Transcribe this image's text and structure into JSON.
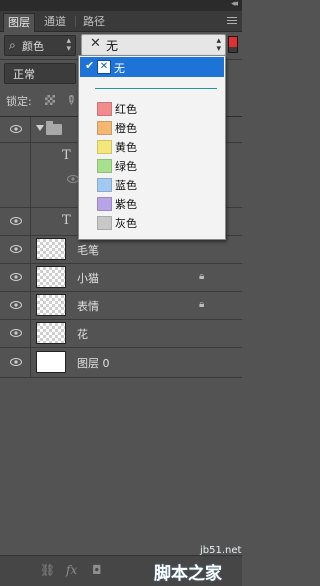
{
  "panel": {
    "tabs": [
      {
        "label": "图层",
        "active": true
      },
      {
        "label": "通道",
        "active": false
      },
      {
        "label": "路径",
        "active": false
      }
    ]
  },
  "filter": {
    "kind_label": "颜色",
    "color_value": "无"
  },
  "blend_mode": "正常",
  "lock_label": "锁定:",
  "layers": [
    {
      "type": "group",
      "name": "",
      "visible": true
    },
    {
      "type": "text",
      "name": "",
      "visible": false
    },
    {
      "type": "text",
      "name": "",
      "visible": true
    },
    {
      "type": "pixel",
      "name": "毛笔",
      "visible": true,
      "locked": false
    },
    {
      "type": "pixel",
      "name": "小猫",
      "visible": true,
      "locked": true
    },
    {
      "type": "pixel",
      "name": "表情",
      "visible": true,
      "locked": true
    },
    {
      "type": "pixel",
      "name": "花",
      "visible": true,
      "locked": false
    },
    {
      "type": "background",
      "name": "图层 0",
      "visible": true,
      "locked": false
    }
  ],
  "dropdown": {
    "selected_label": "无",
    "items": [
      {
        "label": "红色",
        "color": "#f28b8b"
      },
      {
        "label": "橙色",
        "color": "#f5b774"
      },
      {
        "label": "黄色",
        "color": "#f3e77a"
      },
      {
        "label": "绿色",
        "color": "#a9e08e"
      },
      {
        "label": "蓝色",
        "color": "#a3c9f2"
      },
      {
        "label": "紫色",
        "color": "#b8a3e6"
      },
      {
        "label": "灰色",
        "color": "#c8c8c8"
      }
    ]
  },
  "watermark": {
    "site": "jb51.net",
    "brand": "脚本之家"
  },
  "colors": {
    "panel_bg": "#535353",
    "selection": "#1e73d6",
    "filter_toggle": "#e03030"
  }
}
